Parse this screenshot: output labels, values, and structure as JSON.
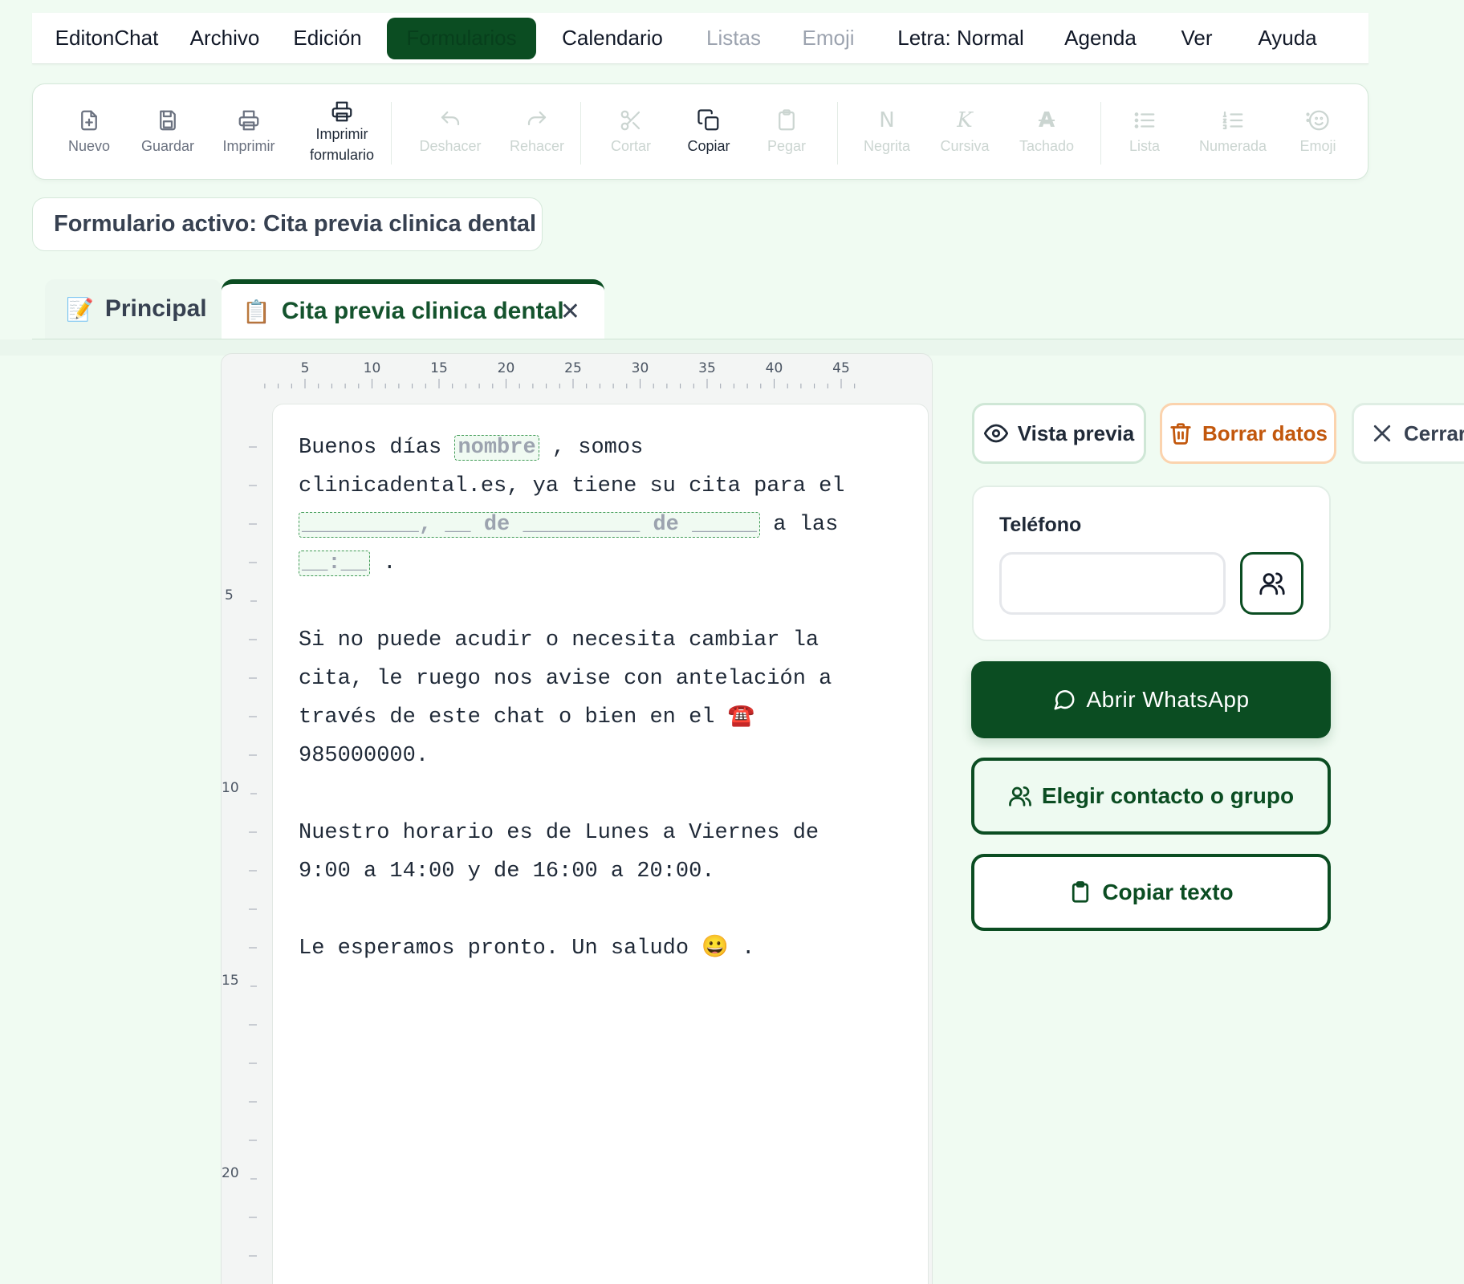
{
  "menubar": {
    "items": [
      {
        "label": "EditonChat",
        "state": "normal"
      },
      {
        "label": "Archivo",
        "state": "normal"
      },
      {
        "label": "Edición",
        "state": "normal"
      },
      {
        "label": "Formularios",
        "state": "active"
      },
      {
        "label": "Calendario",
        "state": "normal"
      },
      {
        "label": "Listas",
        "state": "disabled"
      },
      {
        "label": "Emoji",
        "state": "disabled"
      },
      {
        "label": "Letra: Normal",
        "state": "normal"
      },
      {
        "label": "Agenda",
        "state": "normal"
      },
      {
        "label": "Ver",
        "state": "normal"
      },
      {
        "label": "Ayuda",
        "state": "normal"
      }
    ]
  },
  "toolbar": {
    "nuevo": "Nuevo",
    "guardar": "Guardar",
    "imprimir": "Imprimir",
    "imprimir_formulario_1": "Imprimir",
    "imprimir_formulario_2": "formulario",
    "deshacer": "Deshacer",
    "rehacer": "Rehacer",
    "cortar": "Cortar",
    "copiar": "Copiar",
    "pegar": "Pegar",
    "negrita": "Negrita",
    "negrita_glyph": "N",
    "cursiva": "Cursiva",
    "cursiva_glyph": "K",
    "tachado": "Tachado",
    "tachado_glyph": "A",
    "lista": "Lista",
    "numerada": "Numerada",
    "emoji": "Emoji"
  },
  "active_form": {
    "label": "Formulario activo: Cita previa clinica dental"
  },
  "tabs": [
    {
      "emoji": "📝",
      "label": "Principal",
      "active": false
    },
    {
      "emoji": "📋",
      "label": "Cita previa clinica dental",
      "active": true,
      "close": "✕"
    }
  ],
  "ruler": {
    "horizontal": [
      "5",
      "10",
      "15",
      "20",
      "25",
      "30",
      "35",
      "40",
      "45"
    ],
    "vertical": [
      "5",
      "10",
      "15",
      "20"
    ]
  },
  "document": {
    "p1_a": "Buenos días ",
    "field_nombre": "nombre",
    "p1_b": " , somos\nclinicadental.es, ya tiene su cita para el\n",
    "field_fecha": "_________, __ de _________ de _____",
    "p1_c": " a las\n",
    "field_hora": "__:__",
    "p1_d": " .\n\nSi no puede acudir o necesita cambiar la\ncita, le ruego nos avise con antelación a\ntravés de este chat o bien en el ",
    "phone_emoji": "☎️",
    "p2_end": "\n985000000.\n\nNuestro horario es de Lunes a Viernes de\n9:00 a 14:00 y de 16:00 a 20:00.\n\nLe esperamos pronto. Un saludo ",
    "smile_emoji": "😀",
    "p4_end": " ."
  },
  "panel": {
    "preview_label": "Vista previa",
    "clear_label": "Borrar datos",
    "close_label": "Cerrar",
    "phone_label": "Teléfono",
    "phone_value": "",
    "whatsapp_label": "Abrir WhatsApp",
    "choose_contact_label": "Elegir contacto o grupo",
    "copy_text_label": "Copiar texto"
  },
  "colors": {
    "accent": "#0b4d22",
    "background": "#f0fbf2",
    "warning": "#c2570c",
    "field_border": "#3f9b55"
  }
}
